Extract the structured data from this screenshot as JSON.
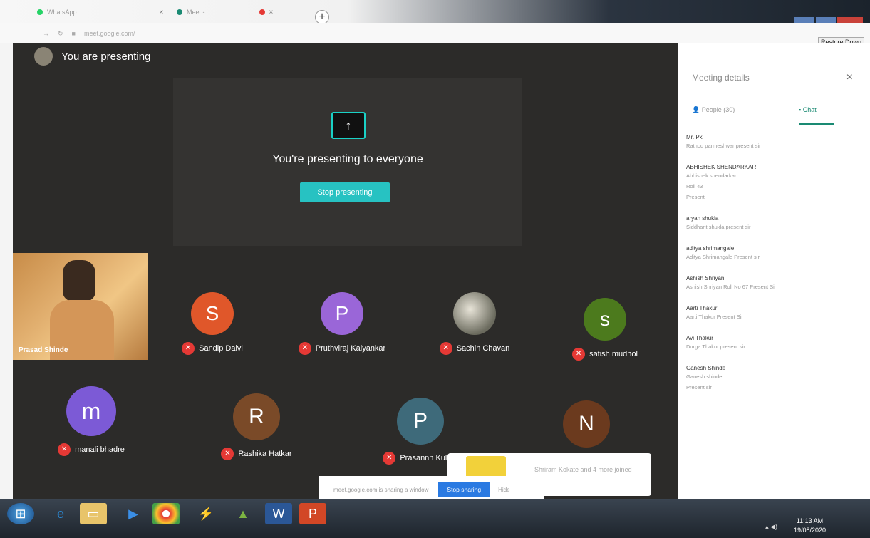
{
  "browser": {
    "tabs": [
      {
        "label": "WhatsApp",
        "color": "#25D366"
      },
      {
        "label": "Meet - ",
        "color": "#1a8a73"
      }
    ],
    "address": "meet.google.com/",
    "tooltip": "Restore Down"
  },
  "meeting": {
    "you_presenting": "You are presenting",
    "present_message": "You're presenting to everyone",
    "stop_presenting": "Stop presenting",
    "self_name": "Prasad Shinde",
    "participants": [
      {
        "initial": "S",
        "name": "Sandip Dalvi",
        "color": "#e0572a"
      },
      {
        "initial": "P",
        "name": "Pruthviraj Kalyankar",
        "color": "#9a66d8"
      },
      {
        "initial": "",
        "name": "Sachin Chavan",
        "color": "#6b6b5e"
      },
      {
        "initial": "s",
        "name": "satish mudhol",
        "color": "#4c7a1d"
      },
      {
        "initial": "m",
        "name": "manali bhadre",
        "color": "#7c5ad6"
      },
      {
        "initial": "R",
        "name": "Rashika Hatkar",
        "color": "#7a4a28"
      },
      {
        "initial": "P",
        "name": "Prasannn Kulthe",
        "color": "#3e6a7a"
      },
      {
        "initial": "N",
        "name": "",
        "color": "#6b3a1e"
      }
    ]
  },
  "panel": {
    "title": "Meeting details",
    "people_tab": "People (30)",
    "chat_tab": "Chat",
    "messages": [
      {
        "sender": "Mr. Pk",
        "lines": [
          "Rathod parmeshwar present sir"
        ]
      },
      {
        "sender": "ABHISHEK SHENDARKAR",
        "lines": [
          "Abhishek shendarkar",
          "Roll 43",
          "Present"
        ]
      },
      {
        "sender": "aryan shukla",
        "lines": [
          "Siddhant shukla present sir"
        ]
      },
      {
        "sender": "aditya shrimangale",
        "lines": [
          "Aditya Shrimangale Present sir"
        ]
      },
      {
        "sender": "Ashish Shriyan",
        "lines": [
          "Ashish Shriyan Roll No 67 Present Sir"
        ]
      },
      {
        "sender": "Aarti Thakur",
        "lines": [
          "Aarti Thakur Present Sir"
        ]
      },
      {
        "sender": "Avi Thakur",
        "lines": [
          "Durga Thakur present sir"
        ]
      },
      {
        "sender": "Ganesh Shinde",
        "lines": [
          "Ganesh shinde",
          "Present sir"
        ]
      }
    ]
  },
  "toast": {
    "text": "Shriram Kokate and 4 more joined"
  },
  "sharebar": {
    "text": "meet.google.com is sharing a window",
    "stop": "Stop sharing",
    "hide": "Hide"
  },
  "taskbar": {
    "time": "11:13 AM",
    "date": "19/08/2020"
  }
}
